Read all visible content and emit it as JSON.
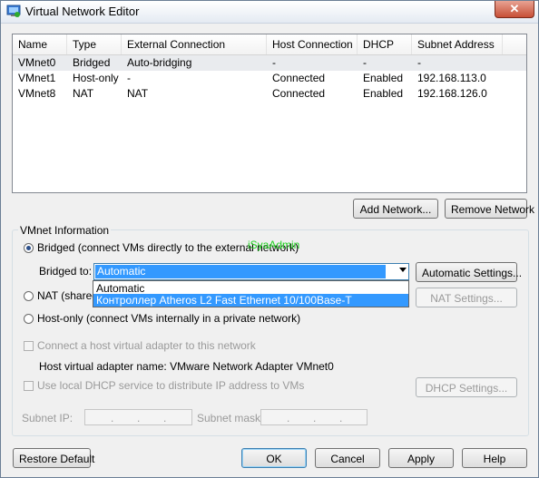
{
  "window": {
    "title": "Virtual Network Editor",
    "close_label": "✕"
  },
  "table": {
    "columns": [
      "Name",
      "Type",
      "External Connection",
      "Host Connection",
      "DHCP",
      "Subnet Address"
    ],
    "rows": [
      [
        "VMnet0",
        "Bridged",
        "Auto-bridging",
        "-",
        "-",
        "-"
      ],
      [
        "VMnet1",
        "Host-only",
        "-",
        "Connected",
        "Enabled",
        "192.168.113.0"
      ],
      [
        "VMnet8",
        "NAT",
        "NAT",
        "Connected",
        "Enabled",
        "192.168.126.0"
      ]
    ],
    "selected_row": 0
  },
  "buttons": {
    "add_network": "Add Network...",
    "remove_network": "Remove Network",
    "automatic_settings": "Automatic Settings...",
    "nat_settings": "NAT Settings...",
    "dhcp_settings": "DHCP Settings...",
    "restore_default": "Restore Default",
    "ok": "OK",
    "cancel": "Cancel",
    "apply": "Apply",
    "help": "Help"
  },
  "vmnet_info": {
    "group_label": "VMnet Information",
    "bridged_label": "Bridged (connect VMs directly to the external network)",
    "bridged_to_label": "Bridged to:",
    "bridged_to_value": "Automatic",
    "bridged_to_options": [
      "Automatic",
      "Контроллер Atheros L2 Fast Ethernet 10/100Base-T"
    ],
    "nat_label": "NAT (shared",
    "host_only_label": "Host-only (connect VMs internally in a private network)",
    "connect_adapter_label": "Connect a host virtual adapter to this network",
    "adapter_name_label": "Host virtual adapter name: VMware Network Adapter VMnet0",
    "dhcp_label": "Use local DHCP service to distribute IP address to VMs",
    "subnet_ip_label": "Subnet IP:",
    "subnet_mask_label": "Subnet mask:",
    "selected_mode": "bridged"
  },
  "watermark": "iSyaAdmin",
  "colors": {
    "selection": "#3399ff",
    "watermark": "#1fd01f"
  },
  "icons": {
    "app": "network-editor-icon",
    "close": "close-icon",
    "dropdown": "chevron-down-icon"
  }
}
